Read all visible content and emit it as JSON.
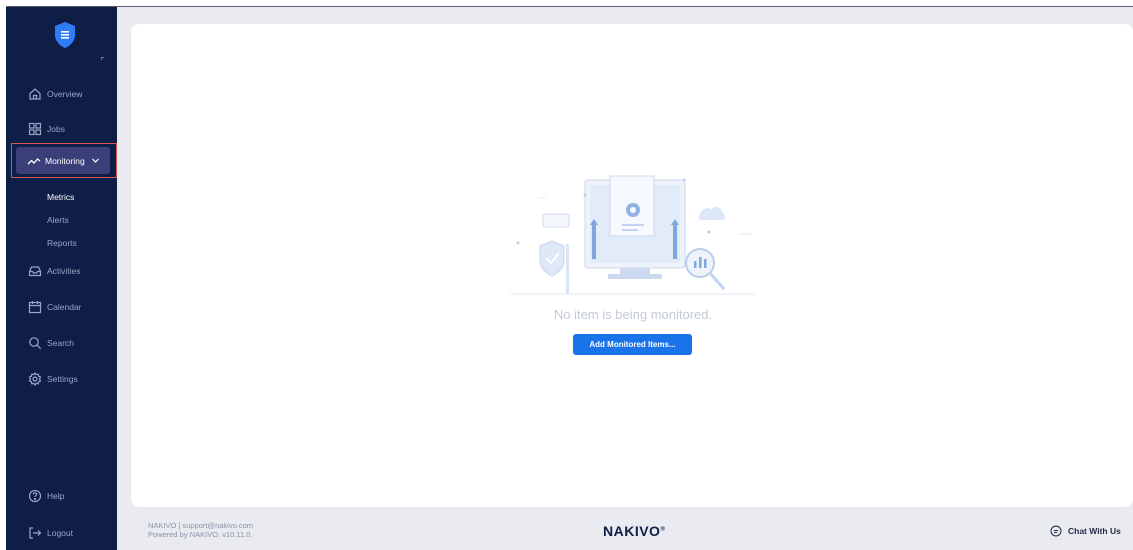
{
  "sidebar": {
    "items": [
      {
        "key": "overview",
        "label": "Overview",
        "icon": "home-icon"
      },
      {
        "key": "jobs",
        "label": "Jobs",
        "icon": "grid-icon"
      },
      {
        "key": "monitoring",
        "label": "Monitoring",
        "icon": "chart-line-icon"
      },
      {
        "key": "activities",
        "label": "Activities",
        "icon": "inbox-icon"
      },
      {
        "key": "calendar",
        "label": "Calendar",
        "icon": "calendar-icon"
      },
      {
        "key": "search",
        "label": "Search",
        "icon": "search-icon"
      },
      {
        "key": "settings",
        "label": "Settings",
        "icon": "gear-icon"
      },
      {
        "key": "help",
        "label": "Help",
        "icon": "help-icon"
      },
      {
        "key": "logout",
        "label": "Logout",
        "icon": "logout-icon"
      }
    ],
    "monitoring_sub": [
      "Metrics",
      "Alerts",
      "Reports"
    ],
    "active_sub": "Metrics"
  },
  "main": {
    "empty_text": "No item is being monitored.",
    "add_button": "Add Monitored Items..."
  },
  "footer": {
    "line1": "NAKIVO | support@nakivo.com",
    "line2": "Powered by NAKIVO. v10.11.0.",
    "brand": "NAKIVO",
    "chat": "Chat With Us"
  },
  "colors": {
    "sidebar_bg": "#0f1e47",
    "accent": "#1a73e8",
    "monitoring_active": "#3a3f7a",
    "highlight_border": "#d9534f"
  }
}
